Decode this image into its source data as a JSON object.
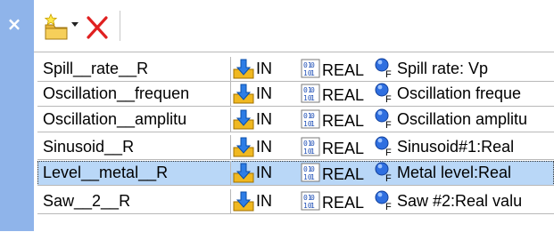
{
  "window": {
    "close_glyph": "×"
  },
  "toolbar": {
    "new_icon": "new-folder-star-icon",
    "delete_icon": "delete-x-icon",
    "delete_color": "#e02020"
  },
  "colors": {
    "sidebar": "#8fb4ea",
    "selected_row": "#b9d7f7",
    "grid_line": "#b8b8b8"
  },
  "variables": [
    {
      "name": "Spill__rate__R",
      "direction": "IN",
      "type": "REAL",
      "description": "Spill rate: Vp",
      "selected": false
    },
    {
      "name": "Oscillation__frequen",
      "direction": "IN",
      "type": "REAL",
      "description": "Oscillation freque",
      "selected": false
    },
    {
      "name": "Oscillation__amplitu",
      "direction": "IN",
      "type": "REAL",
      "description": "Oscillation amplitu",
      "selected": false
    },
    {
      "name": "Sinusoid__R",
      "direction": "IN",
      "type": "REAL",
      "description": "Sinusoid#1:Real",
      "selected": false
    },
    {
      "name": "Level__metal__R",
      "direction": "IN",
      "type": "REAL",
      "description": "Metal level:Real",
      "selected": true
    },
    {
      "name": "Saw__2__R",
      "direction": "IN",
      "type": "REAL",
      "description": "Saw #2:Real valu",
      "selected": false
    }
  ]
}
